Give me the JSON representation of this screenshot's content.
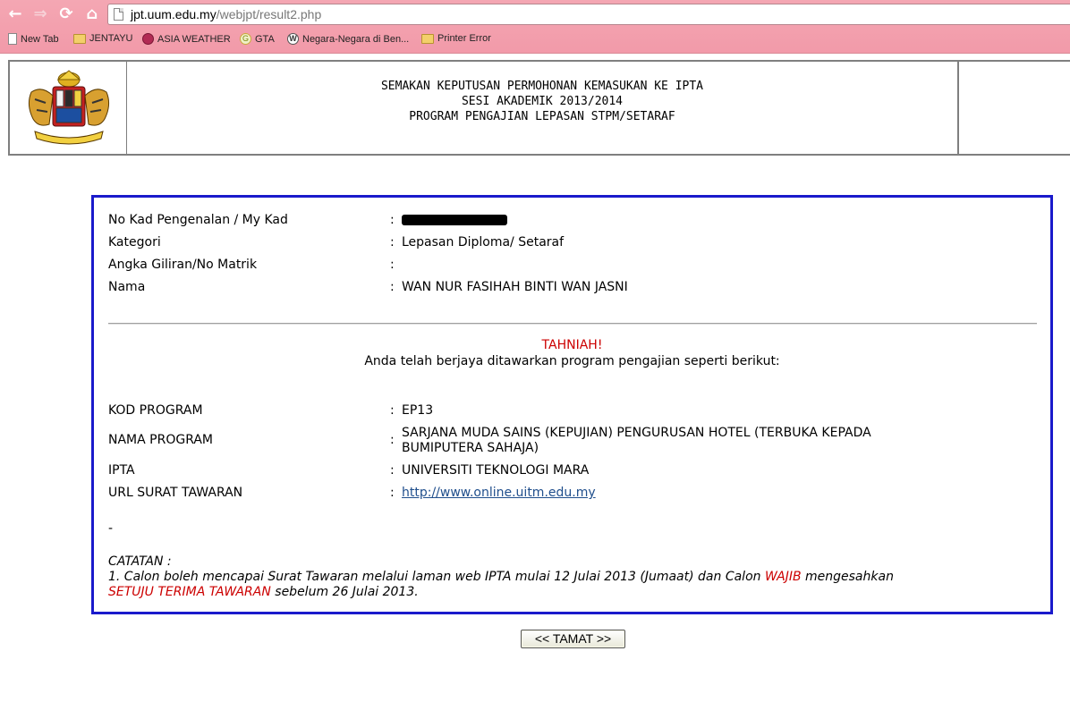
{
  "browser": {
    "url_host": "jpt.uum.edu.my",
    "url_path": "/webjpt/result2.php",
    "nav_icons": [
      "back-icon",
      "forward-icon",
      "reload-icon",
      "home-icon"
    ],
    "bookmarks": [
      {
        "label": "New Tab",
        "icon": "page-icon"
      },
      {
        "label": "JENTAYU",
        "icon": "folder-icon"
      },
      {
        "label": "ASIA WEATHER",
        "icon": "globe-icon"
      },
      {
        "label": "GTA",
        "icon": "gta-icon"
      },
      {
        "label": "Negara-Negara di Ben...",
        "icon": "wordpress-icon"
      },
      {
        "label": "Printer Error",
        "icon": "folder-icon"
      }
    ],
    "theme_color": "#f4a7b3"
  },
  "header": {
    "line1": "SEMAKAN KEPUTUSAN PERMOHONAN KEMASUKAN KE IPTA",
    "line2": "SESI AKADEMIK 2013/2014",
    "line3": "PROGRAM PENGAJIAN LEPASAN STPM/SETARAF"
  },
  "applicant": {
    "fields": [
      {
        "label": "No Kad Pengenalan / My Kad",
        "value": ""
      },
      {
        "label": "Kategori",
        "value": "Lepasan Diploma/ Setaraf"
      },
      {
        "label": "Angka Giliran/No Matrik",
        "value": ""
      },
      {
        "label": "Nama",
        "value": "WAN NUR FASIHAH BINTI WAN JASNI"
      }
    ]
  },
  "result": {
    "congrats": "TAHNIAH!",
    "message": "Anda telah berjaya ditawarkan program pengajian seperti berikut:",
    "fields": [
      {
        "label": "KOD PROGRAM",
        "value": "EP13"
      },
      {
        "label": "NAMA PROGRAM",
        "value_line1": "SARJANA MUDA SAINS (KEPUJIAN) PENGURUSAN HOTEL (TERBUKA KEPADA",
        "value_line2": "BUMIPUTERA SAHAJA)"
      },
      {
        "label": "IPTA",
        "value": "UNIVERSITI TEKNOLOGI MARA"
      },
      {
        "label": "URL SURAT TAWARAN",
        "value": "http://www.online.uitm.edu.my"
      }
    ],
    "dash": "-",
    "colon": ":"
  },
  "note": {
    "title": "CATATAN :",
    "part1": "1. Calon boleh mencapai Surat Tawaran melalui laman web IPTA mulai 12 Julai 2013 (Jumaat) dan Calon ",
    "wajib": "WAJIB",
    "part2": " mengesahkan",
    "setuju": "SETUJU TERIMA TAWARAN",
    "part3": " sebelum 26 Julai 2013."
  },
  "footer": {
    "button_label": "<< TAMAT >>"
  },
  "colors": {
    "box_border": "#1a1acb",
    "highlight_red": "#cc0000",
    "link": "#1f4e8c"
  }
}
